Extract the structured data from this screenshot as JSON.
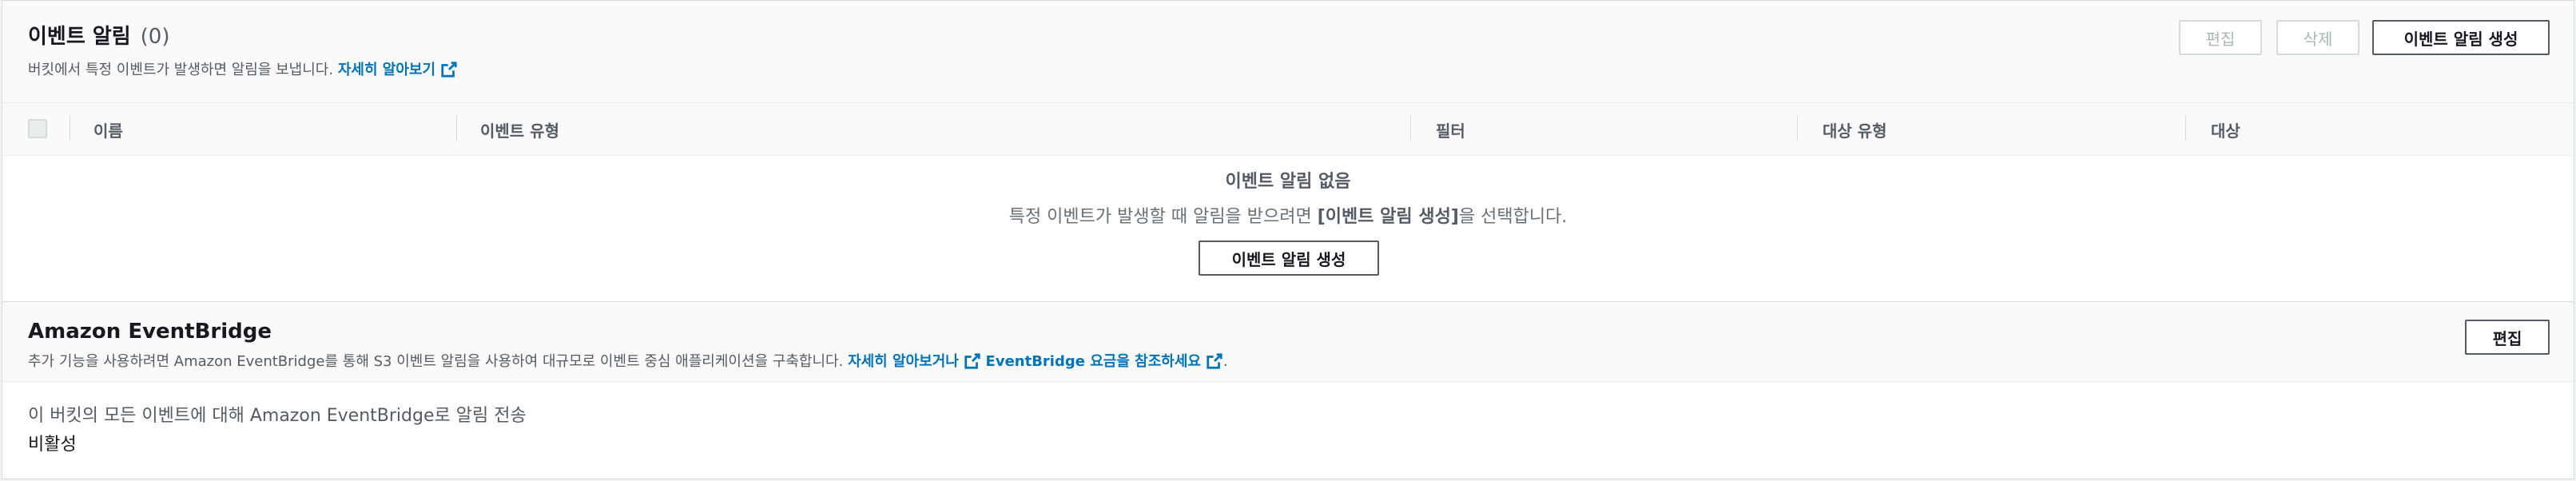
{
  "events": {
    "title": "이벤트 알림",
    "count": "(0)",
    "description": "버킷에서 특정 이벤트가 발생하면 알림을 보냅니다.",
    "learn_more": "자세히 알아보기",
    "buttons": {
      "edit": "편집",
      "delete": "삭제",
      "create": "이벤트 알림 생성"
    },
    "columns": [
      "이름",
      "이벤트 유형",
      "필터",
      "대상 유형",
      "대상"
    ],
    "empty": {
      "title": "이벤트 알림 없음",
      "msg_before": "특정 이벤트가 발생할 때 알림을 받으려면 ",
      "msg_bold": "[이벤트 알림 생성]",
      "msg_after": "을 선택합니다.",
      "button": "이벤트 알림 생성"
    }
  },
  "eventbridge": {
    "title": "Amazon EventBridge",
    "description": "추가 기능을 사용하려면 Amazon EventBridge를 통해 S3 이벤트 알림을 사용하여 대규모로 이벤트 중심 애플리케이션을 구축합니다.",
    "link1": "자세히 알아보거나",
    "link2": "EventBridge 요금을 참조하세요",
    "period": ".",
    "edit": "편집",
    "setting_label": "이 버킷의 모든 이벤트에 대해 Amazon EventBridge로 알림 전송",
    "setting_value": "비활성"
  },
  "colors": {
    "link": "#0073bb",
    "border": "#d5dbdb",
    "header_bg": "#fafafa"
  }
}
